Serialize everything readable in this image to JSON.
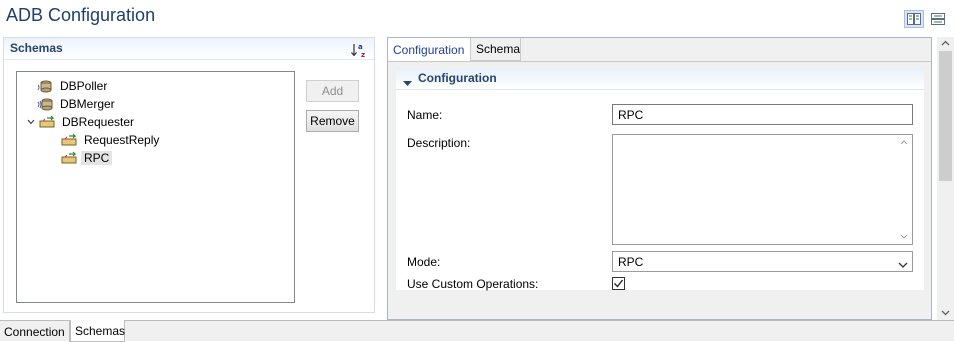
{
  "header": {
    "title": "ADB Configuration"
  },
  "toolbar": {
    "icons": [
      "horizontal-layout-icon",
      "vertical-layout-icon"
    ]
  },
  "schemas_section": {
    "label": "Schemas",
    "sort_icon": "sort-az-icon",
    "tree": [
      {
        "label": "DBPoller",
        "icon": "db-poller-icon",
        "expanded": null,
        "selected": false,
        "level": 0
      },
      {
        "label": "DBMerger",
        "icon": "db-merger-icon",
        "expanded": null,
        "selected": false,
        "level": 0
      },
      {
        "label": "DBRequester",
        "icon": "db-requester-icon",
        "expanded": true,
        "selected": false,
        "level": 0
      },
      {
        "label": "RequestReply",
        "icon": "request-reply-icon",
        "expanded": null,
        "selected": false,
        "level": 1
      },
      {
        "label": "RPC",
        "icon": "rpc-icon",
        "expanded": null,
        "selected": true,
        "level": 1
      }
    ],
    "add_label": "Add",
    "remove_label": "Remove"
  },
  "detail_panel": {
    "tabs": [
      {
        "label": "Configuration",
        "active": true
      },
      {
        "label": "Schema",
        "active": false
      }
    ],
    "section_title": "Configuration",
    "name_label": "Name:",
    "name_value": "RPC",
    "description_label": "Description:",
    "description_value": "",
    "mode_label": "Mode:",
    "mode_value": "RPC",
    "custom_ops_label": "Use Custom Operations:",
    "custom_ops_checked": true
  },
  "bottom_tabs": [
    {
      "label": "Connection",
      "active": false
    },
    {
      "label": "Schemas",
      "active": true
    }
  ],
  "colors": {
    "title": "#1f3f6c",
    "section_header": "#25456f",
    "active_tab_text": "#1f3f9c",
    "selection": "#e4e4e4"
  }
}
